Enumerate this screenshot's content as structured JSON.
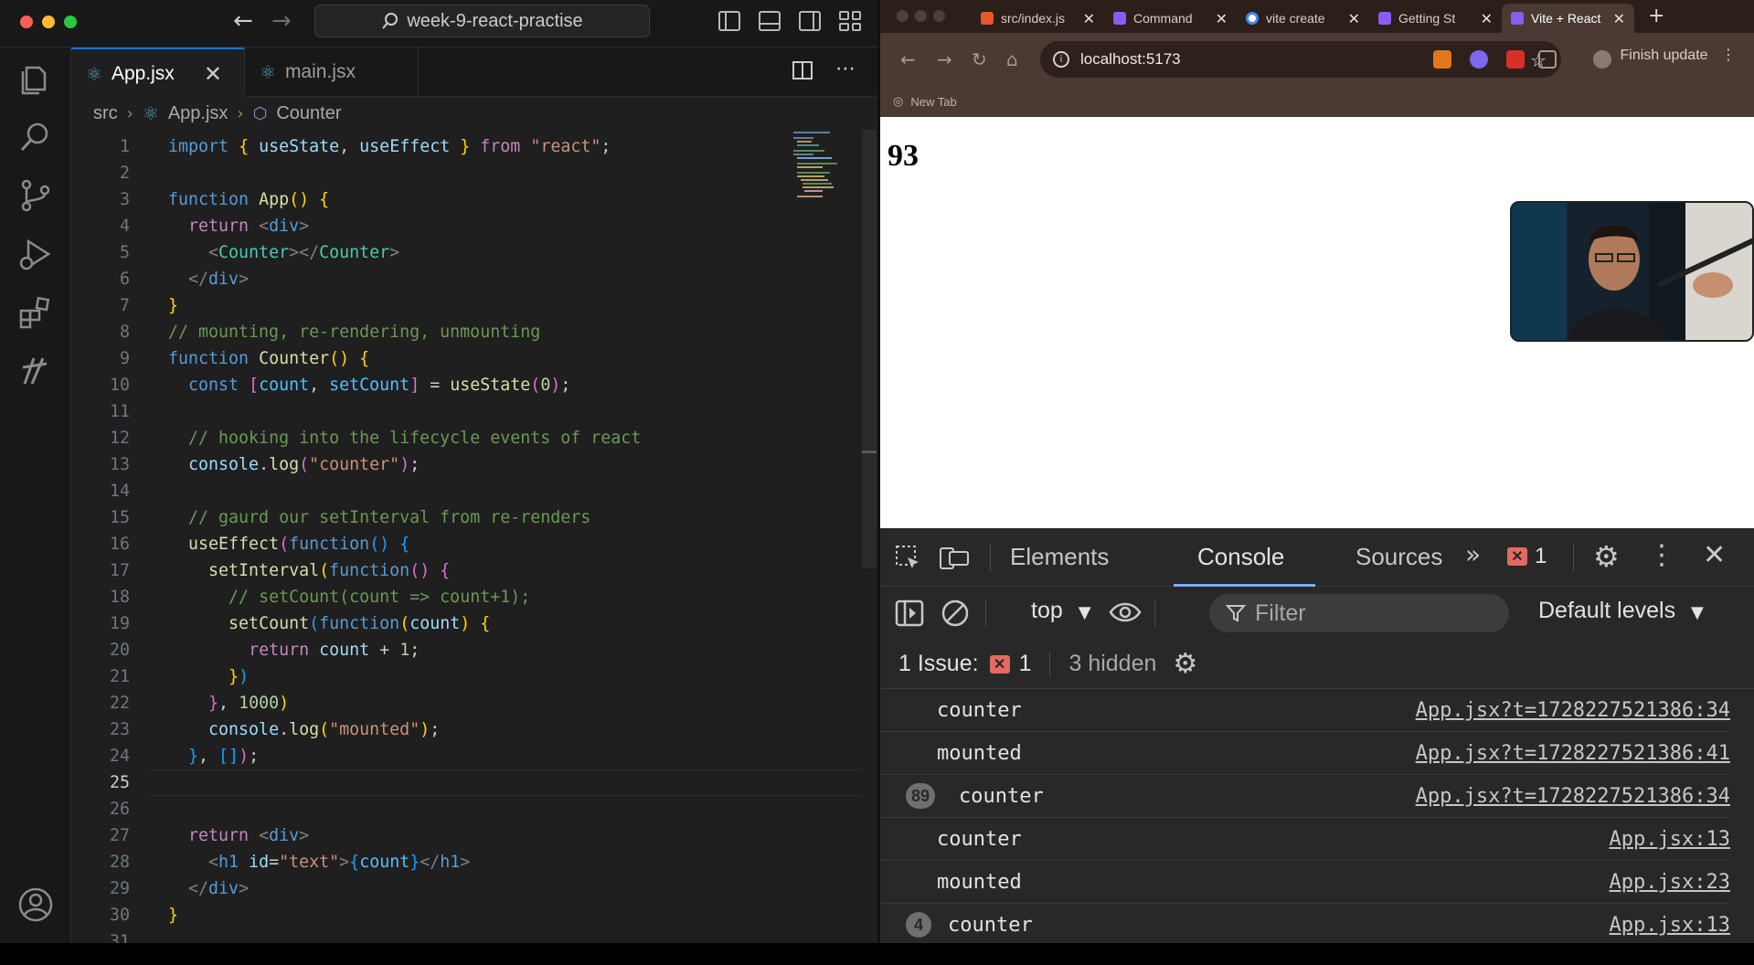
{
  "vscode": {
    "search_text": "week-9-react-practise",
    "tabs": [
      {
        "label": "App.jsx",
        "active": true
      },
      {
        "label": "main.jsx",
        "active": false
      }
    ],
    "breadcrumb": [
      "src",
      "App.jsx",
      "Counter"
    ],
    "current_line": 25,
    "lines": [
      [
        [
          "kw",
          "import"
        ],
        [
          "t",
          " "
        ],
        [
          "b1",
          "{"
        ],
        [
          "t",
          " "
        ],
        [
          "var",
          "useState"
        ],
        [
          "t",
          ", "
        ],
        [
          "var",
          "useEffect"
        ],
        [
          "t",
          " "
        ],
        [
          "b1",
          "}"
        ],
        [
          "t",
          " "
        ],
        [
          "ctl",
          "from"
        ],
        [
          "t",
          " "
        ],
        [
          "str",
          "\"react\""
        ],
        [
          "t",
          ";"
        ]
      ],
      [],
      [
        [
          "kw",
          "function"
        ],
        [
          "t",
          " "
        ],
        [
          "fn",
          "App"
        ],
        [
          "b1",
          "()"
        ],
        [
          "t",
          " "
        ],
        [
          "b1",
          "{"
        ]
      ],
      [
        [
          "t",
          "  "
        ],
        [
          "ctl",
          "return"
        ],
        [
          "t",
          " "
        ],
        [
          "ang",
          "<"
        ],
        [
          "tag",
          "div"
        ],
        [
          "ang",
          ">"
        ]
      ],
      [
        [
          "t",
          "    "
        ],
        [
          "ang",
          "<"
        ],
        [
          "cmp",
          "Counter"
        ],
        [
          "ang",
          "></"
        ],
        [
          "cmp",
          "Counter"
        ],
        [
          "ang",
          ">"
        ]
      ],
      [
        [
          "t",
          "  "
        ],
        [
          "ang",
          "</"
        ],
        [
          "tag",
          "div"
        ],
        [
          "ang",
          ">"
        ]
      ],
      [
        [
          "b1",
          "}"
        ]
      ],
      [
        [
          "cm",
          "// mounting, re-rendering, unmounting"
        ]
      ],
      [
        [
          "kw",
          "function"
        ],
        [
          "t",
          " "
        ],
        [
          "fn",
          "Counter"
        ],
        [
          "b1",
          "()"
        ],
        [
          "t",
          " "
        ],
        [
          "b1",
          "{"
        ]
      ],
      [
        [
          "t",
          "  "
        ],
        [
          "kw",
          "const"
        ],
        [
          "t",
          " "
        ],
        [
          "b2",
          "["
        ],
        [
          "cst",
          "count"
        ],
        [
          "t",
          ", "
        ],
        [
          "cst",
          "setCount"
        ],
        [
          "b2",
          "]"
        ],
        [
          "t",
          " = "
        ],
        [
          "fn",
          "useState"
        ],
        [
          "b2",
          "("
        ],
        [
          "num",
          "0"
        ],
        [
          "b2",
          ")"
        ],
        [
          "t",
          ";"
        ]
      ],
      [],
      [
        [
          "t",
          "  "
        ],
        [
          "cm",
          "// hooking into the lifecycle events of react"
        ]
      ],
      [
        [
          "t",
          "  "
        ],
        [
          "var",
          "console"
        ],
        [
          "t",
          "."
        ],
        [
          "fn",
          "log"
        ],
        [
          "b2",
          "("
        ],
        [
          "str",
          "\"counter\""
        ],
        [
          "b2",
          ")"
        ],
        [
          "t",
          ";"
        ]
      ],
      [],
      [
        [
          "t",
          "  "
        ],
        [
          "cm",
          "// gaurd our setInterval from re-renders"
        ]
      ],
      [
        [
          "t",
          "  "
        ],
        [
          "fn",
          "useEffect"
        ],
        [
          "b2",
          "("
        ],
        [
          "kw",
          "function"
        ],
        [
          "b3",
          "()"
        ],
        [
          "t",
          " "
        ],
        [
          "b3",
          "{"
        ]
      ],
      [
        [
          "t",
          "    "
        ],
        [
          "fn",
          "setInterval"
        ],
        [
          "b1",
          "("
        ],
        [
          "kw",
          "function"
        ],
        [
          "b2",
          "()"
        ],
        [
          "t",
          " "
        ],
        [
          "b2",
          "{"
        ]
      ],
      [
        [
          "t",
          "      "
        ],
        [
          "cm",
          "// setCount(count => count+1);"
        ]
      ],
      [
        [
          "t",
          "      "
        ],
        [
          "fn",
          "setCount"
        ],
        [
          "b3",
          "("
        ],
        [
          "kw",
          "function"
        ],
        [
          "b1",
          "("
        ],
        [
          "var",
          "count"
        ],
        [
          "b1",
          ")"
        ],
        [
          "t",
          " "
        ],
        [
          "b1",
          "{"
        ]
      ],
      [
        [
          "t",
          "        "
        ],
        [
          "ctl",
          "return"
        ],
        [
          "t",
          " "
        ],
        [
          "var",
          "count"
        ],
        [
          "t",
          " + "
        ],
        [
          "num",
          "1"
        ],
        [
          "t",
          ";"
        ]
      ],
      [
        [
          "t",
          "      "
        ],
        [
          "b1",
          "}"
        ],
        [
          "b3",
          ")"
        ]
      ],
      [
        [
          "t",
          "    "
        ],
        [
          "b2",
          "}"
        ],
        [
          "t",
          ", "
        ],
        [
          "num",
          "1000"
        ],
        [
          "b1",
          ")"
        ]
      ],
      [
        [
          "t",
          "    "
        ],
        [
          "var",
          "console"
        ],
        [
          "t",
          "."
        ],
        [
          "fn",
          "log"
        ],
        [
          "b1",
          "("
        ],
        [
          "str",
          "\"mounted\""
        ],
        [
          "b1",
          ")"
        ],
        [
          "t",
          ";"
        ]
      ],
      [
        [
          "t",
          "  "
        ],
        [
          "b3",
          "}"
        ],
        [
          "t",
          ", "
        ],
        [
          "b3",
          "[]"
        ],
        [
          "b2",
          ")"
        ],
        [
          "t",
          ";"
        ]
      ],
      [],
      [],
      [
        [
          "t",
          "  "
        ],
        [
          "ctl",
          "return"
        ],
        [
          "t",
          " "
        ],
        [
          "ang",
          "<"
        ],
        [
          "tag",
          "div"
        ],
        [
          "ang",
          ">"
        ]
      ],
      [
        [
          "t",
          "    "
        ],
        [
          "ang",
          "<"
        ],
        [
          "tag",
          "h1"
        ],
        [
          "t",
          " "
        ],
        [
          "attr",
          "id"
        ],
        [
          "t",
          "="
        ],
        [
          "str",
          "\"text\""
        ],
        [
          "ang",
          ">"
        ],
        [
          "b3",
          "{"
        ],
        [
          "cst",
          "count"
        ],
        [
          "b3",
          "}"
        ],
        [
          "ang",
          "</"
        ],
        [
          "tag",
          "h1"
        ],
        [
          "ang",
          ">"
        ]
      ],
      [
        [
          "t",
          "  "
        ],
        [
          "ang",
          "</"
        ],
        [
          "tag",
          "div"
        ],
        [
          "ang",
          ">"
        ]
      ],
      [
        [
          "b1",
          "}"
        ]
      ],
      []
    ]
  },
  "chrome": {
    "tabs": [
      {
        "title": "src/index.js",
        "color": "#e8562a",
        "active": false
      },
      {
        "title": "Command",
        "color": "#8a5cf5",
        "active": false
      },
      {
        "title": "vite create",
        "color": "#4285f4",
        "active": false
      },
      {
        "title": "Getting St",
        "color": "#8a5cf5",
        "active": false
      },
      {
        "title": "Vite + React",
        "color": "#8a5cf5",
        "active": true
      }
    ],
    "url": "localhost:5173",
    "finish_update": "Finish update",
    "bookmark": "New Tab",
    "page_heading": "93",
    "devtools": {
      "tabs": [
        "Elements",
        "Console",
        "Sources"
      ],
      "error_count": "1",
      "context": "top",
      "filter_placeholder": "Filter",
      "levels": "Default levels",
      "issues_label": "1 Issue:",
      "issues_count": "1",
      "hidden_label": "3 hidden",
      "logs": [
        {
          "message": "counter",
          "source": "App.jsx?t=1728227521386:34",
          "repeat": ""
        },
        {
          "message": "mounted",
          "source": "App.jsx?t=1728227521386:41",
          "repeat": ""
        },
        {
          "message": "counter",
          "source": "App.jsx?t=1728227521386:34",
          "repeat": "89"
        },
        {
          "message": "counter",
          "source": "App.jsx:13",
          "repeat": ""
        },
        {
          "message": "mounted",
          "source": "App.jsx:23",
          "repeat": ""
        },
        {
          "message": "counter",
          "source": "App.jsx:13",
          "repeat": "4"
        }
      ]
    }
  }
}
